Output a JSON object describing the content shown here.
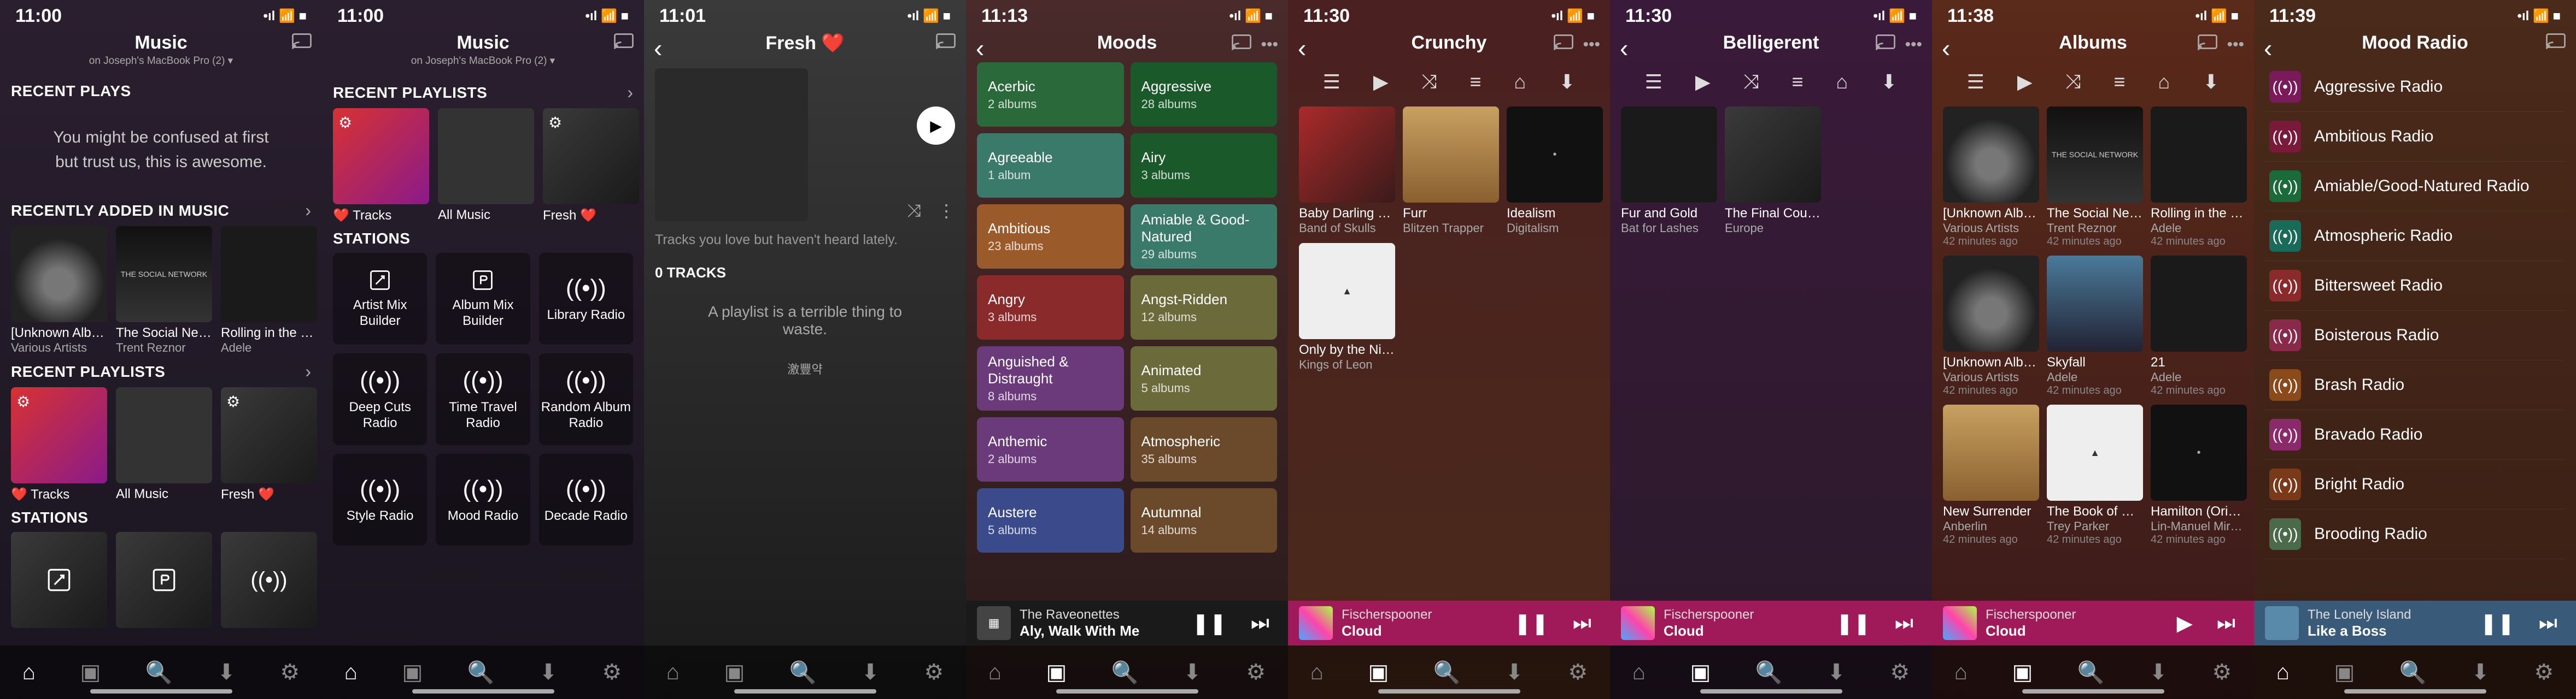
{
  "statusbar": {
    "icons": "📶 📡 🔋"
  },
  "screens": [
    {
      "time": "11:00",
      "title": "Music",
      "subtitle": "on Joseph's MacBook Pro (2) ▾",
      "sections": {
        "recent_plays": "RECENT PLAYS",
        "recently_added": "RECENTLY ADDED IN MUSIC",
        "recent_playlists": "RECENT PLAYLISTS",
        "stations": "STATIONS"
      },
      "empty": "You might be confused at first\nbut trust us, this is awesome.",
      "albums": [
        {
          "t1": "[Unknown Album]",
          "t2": "Various Artists"
        },
        {
          "t1": "The Social Netw…",
          "t2": "Trent Reznor"
        },
        {
          "t1": "Rolling in the De…",
          "t2": "Adele"
        }
      ],
      "playlists": [
        {
          "t1": "❤️ Tracks"
        },
        {
          "t1": "All Music"
        },
        {
          "t1": "Fresh ❤️"
        }
      ]
    },
    {
      "time": "11:00",
      "title": "Music",
      "subtitle": "on Joseph's MacBook Pro (2) ▾",
      "sections": {
        "recent_playlists": "RECENT PLAYLISTS",
        "stations": "STATIONS"
      },
      "playlists": [
        {
          "t1": "❤️ Tracks"
        },
        {
          "t1": "All Music"
        },
        {
          "t1": "Fresh ❤️"
        }
      ],
      "stations": [
        {
          "label": "Artist Mix Builder",
          "icon": "artist"
        },
        {
          "label": "Album Mix Builder",
          "icon": "album"
        },
        {
          "label": "Library Radio",
          "icon": "radio"
        },
        {
          "label": "Deep Cuts Radio",
          "icon": "radio"
        },
        {
          "label": "Time Travel Radio",
          "icon": "radio"
        },
        {
          "label": "Random Album Radio",
          "icon": "radio"
        },
        {
          "label": "Style Radio",
          "icon": "radio"
        },
        {
          "label": "Mood Radio",
          "icon": "radio"
        },
        {
          "label": "Decade Radio",
          "icon": "radio"
        }
      ]
    },
    {
      "time": "11:01",
      "title": "Fresh ❤️",
      "desc": "Tracks you love but haven't heard lately.",
      "tracks_header": "0 TRACKS",
      "empty_big": "A playlist is a terrible thing to waste.",
      "empty_small": "激豐약"
    },
    {
      "time": "11:13",
      "title": "Moods",
      "moods": [
        {
          "t": "Acerbic",
          "c": "2 albums",
          "cl": "mc-green"
        },
        {
          "t": "Aggressive",
          "c": "28 albums",
          "cl": "mc-dgreen"
        },
        {
          "t": "Agreeable",
          "c": "1 album",
          "cl": "mc-teal"
        },
        {
          "t": "Airy",
          "c": "3 albums",
          "cl": "mc-dgreen"
        },
        {
          "t": "Ambitious",
          "c": "23 albums",
          "cl": "mc-orange"
        },
        {
          "t": "Amiable & Good-Natured",
          "c": "29 albums",
          "cl": "mc-teal"
        },
        {
          "t": "Angry",
          "c": "3 albums",
          "cl": "mc-red"
        },
        {
          "t": "Angst-Ridden",
          "c": "12 albums",
          "cl": "mc-olive"
        },
        {
          "t": "Anguished & Distraught",
          "c": "8 albums",
          "cl": "mc-purple"
        },
        {
          "t": "Animated",
          "c": "5 albums",
          "cl": "mc-olive"
        },
        {
          "t": "Anthemic",
          "c": "2 albums",
          "cl": "mc-purple"
        },
        {
          "t": "Atmospheric",
          "c": "35 albums",
          "cl": "mc-brown"
        },
        {
          "t": "Austere",
          "c": "5 albums",
          "cl": "mc-blue"
        },
        {
          "t": "Autumnal",
          "c": "14 albums",
          "cl": "mc-brown"
        }
      ],
      "nowplaying": {
        "artist": "The Raveonettes",
        "track": "Aly, Walk With Me",
        "style": "np-dark"
      }
    },
    {
      "time": "11:30",
      "title": "Crunchy",
      "albums": [
        {
          "t1": "Baby Darling D…",
          "t2": "Band of Skulls",
          "art": "grad3"
        },
        {
          "t1": "Furr",
          "t2": "Blitzen Trapper",
          "art": "tan"
        },
        {
          "t1": "Idealism",
          "t2": "Digitalism",
          "art": "blk"
        },
        {
          "t1": "Only by the Nig…",
          "t2": "Kings of Leon",
          "art": "wht"
        }
      ],
      "nowplaying": {
        "artist": "Fischerspooner",
        "track": "Cloud",
        "style": "np-pink"
      }
    },
    {
      "time": "11:30",
      "title": "Belligerent",
      "albums": [
        {
          "t1": "Fur and Gold",
          "t2": "Bat for Lashes",
          "art": "dark"
        },
        {
          "t1": "The Final Coun…",
          "t2": "Europe",
          "art": "grad2"
        }
      ],
      "nowplaying": {
        "artist": "Fischerspooner",
        "track": "Cloud",
        "style": "np-pink"
      }
    },
    {
      "time": "11:38",
      "title": "Albums",
      "albums": [
        {
          "t1": "[Unknown Albu…",
          "t2": "Various Artists",
          "t3": "42 minutes ago",
          "art": "bw"
        },
        {
          "t1": "The Social Net…",
          "t2": "Trent Reznor",
          "t3": "42 minutes ago",
          "art": "net"
        },
        {
          "t1": "Rolling in the D…",
          "t2": "Adele",
          "t3": "42 minutes ago",
          "art": "dark"
        },
        {
          "t1": "[Unknown Albu…",
          "t2": "Various Artists",
          "t3": "42 minutes ago",
          "art": "bw"
        },
        {
          "t1": "Skyfall",
          "t2": "Adele",
          "t3": "42 minutes ago",
          "art": "sky"
        },
        {
          "t1": "21",
          "t2": "Adele",
          "t3": "42 minutes ago",
          "art": "dark"
        },
        {
          "t1": "New Surrender",
          "t2": "Anberlin",
          "t3": "42 minutes ago",
          "art": "tan"
        },
        {
          "t1": "The Book of M…",
          "t2": "Trey Parker",
          "t3": "42 minutes ago",
          "art": "wht"
        },
        {
          "t1": "Hamilton (Origi…",
          "t2": "Lin-Manuel Mir…",
          "t3": "42 minutes ago",
          "art": "blk"
        }
      ],
      "nowplaying": {
        "artist": "Fischerspooner",
        "track": "Cloud",
        "style": "np-pink",
        "showplay": true
      }
    },
    {
      "time": "11:39",
      "title": "Mood Radio",
      "radios": [
        {
          "label": "Aggressive Radio",
          "color": "#7a1a5a"
        },
        {
          "label": "Ambitious Radio",
          "color": "#7a1a3a"
        },
        {
          "label": "Amiable/Good-Natured Radio",
          "color": "#1a6a3a"
        },
        {
          "label": "Atmospheric Radio",
          "color": "#1a6a5a"
        },
        {
          "label": "Bittersweet Radio",
          "color": "#8a2a2a"
        },
        {
          "label": "Boisterous Radio",
          "color": "#8a2a4a"
        },
        {
          "label": "Brash Radio",
          "color": "#8a4a1a"
        },
        {
          "label": "Bravado Radio",
          "color": "#8a2a6a"
        },
        {
          "label": "Bright Radio",
          "color": "#7a3a1a"
        },
        {
          "label": "Brooding Radio",
          "color": "#4a6a4a"
        }
      ],
      "nowplaying": {
        "artist": "The Lonely Island",
        "track": "Like a Boss",
        "style": "np-blue"
      }
    }
  ],
  "tabbar_icons": [
    "home",
    "browse",
    "search",
    "download",
    "settings"
  ],
  "playbar_icons": {
    "filter": "☰",
    "play": "▶",
    "shuffle": "⤨",
    "queue": "≡",
    "save": "⌂",
    "download": "⬇"
  }
}
